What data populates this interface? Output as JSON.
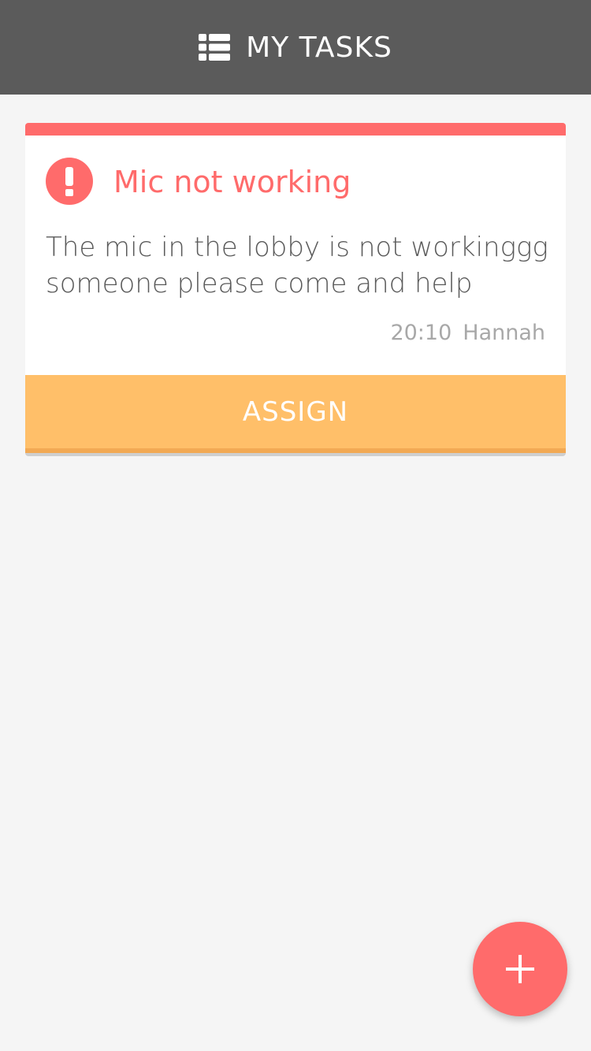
{
  "header": {
    "title": "MY TASKS",
    "icon": "list-icon"
  },
  "task": {
    "status_icon": "exclamation-icon",
    "title": "Mic not working",
    "description": "The mic in the lobby is not workinggg someone please come and help",
    "time": "20:10",
    "author": "Hannah",
    "assign_label": "ASSIGN"
  },
  "fab": {
    "icon": "plus-icon"
  },
  "colors": {
    "header": "#5b5b5b",
    "accent_red": "#ff6b6b",
    "assign_orange": "#ffbf69",
    "background": "#f5f5f5"
  }
}
